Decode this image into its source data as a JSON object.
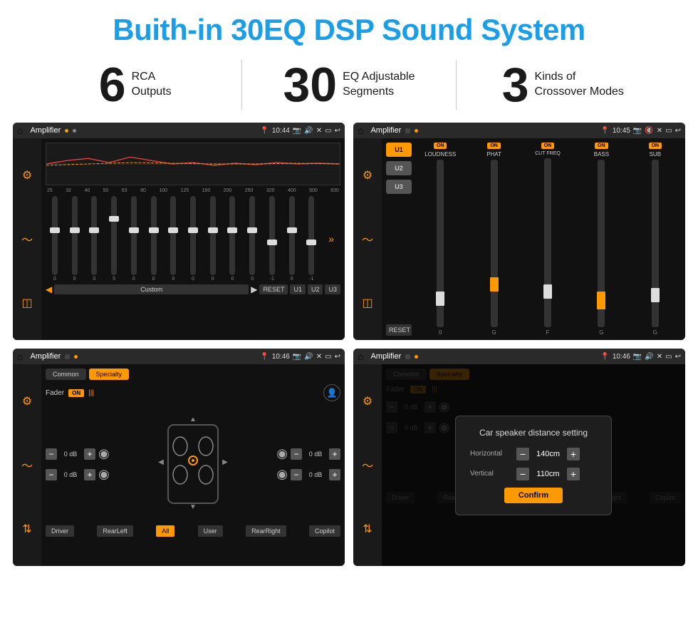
{
  "page": {
    "title": "Buith-in 30EQ DSP Sound System",
    "accent_color": "#1a9ee8"
  },
  "stats": [
    {
      "number": "6",
      "text_line1": "RCA",
      "text_line2": "Outputs"
    },
    {
      "number": "30",
      "text_line1": "EQ Adjustable",
      "text_line2": "Segments"
    },
    {
      "number": "3",
      "text_line1": "Kinds of",
      "text_line2": "Crossover Modes"
    }
  ],
  "screens": [
    {
      "id": "eq-screen",
      "title": "Amplifier",
      "time": "10:44",
      "type": "equalizer"
    },
    {
      "id": "amp-screen",
      "title": "Amplifier",
      "time": "10:45",
      "type": "amplifier"
    },
    {
      "id": "fader-screen",
      "title": "Amplifier",
      "time": "10:46",
      "type": "fader"
    },
    {
      "id": "dialog-screen",
      "title": "Amplifier",
      "time": "10:46",
      "type": "dialog"
    }
  ],
  "eq": {
    "freq_labels": [
      "25",
      "32",
      "40",
      "50",
      "63",
      "80",
      "100",
      "125",
      "160",
      "200",
      "250",
      "320",
      "400",
      "500",
      "630"
    ],
    "values": [
      "0",
      "0",
      "0",
      "5",
      "0",
      "0",
      "0",
      "0",
      "0",
      "0",
      "0",
      "-1",
      "0",
      "-1"
    ],
    "preset": "Custom",
    "buttons": [
      "RESET",
      "U1",
      "U2",
      "U3"
    ]
  },
  "amp": {
    "presets": [
      "U1",
      "U2",
      "U3"
    ],
    "channels": [
      {
        "label": "LOUDNESS",
        "on": true
      },
      {
        "label": "PHAT",
        "on": true
      },
      {
        "label": "CUT FREQ",
        "on": true
      },
      {
        "label": "BASS",
        "on": true
      },
      {
        "label": "SUB",
        "on": true
      }
    ],
    "reset_label": "RESET"
  },
  "fader": {
    "tabs": [
      "Common",
      "Specialty"
    ],
    "active_tab": "Specialty",
    "fader_label": "Fader",
    "on_label": "ON",
    "controls": [
      {
        "value": "0 dB"
      },
      {
        "value": "0 dB"
      },
      {
        "value": "0 dB"
      },
      {
        "value": "0 dB"
      }
    ],
    "buttons": [
      "Driver",
      "RearLeft",
      "All",
      "User",
      "RearRight",
      "Copilot"
    ]
  },
  "dialog": {
    "tabs": [
      "Common",
      "Specialty"
    ],
    "title": "Car speaker distance setting",
    "horizontal_label": "Horizontal",
    "horizontal_value": "140cm",
    "vertical_label": "Vertical",
    "vertical_value": "110cm",
    "confirm_label": "Confirm",
    "side_controls": [
      {
        "value": "0 dB"
      },
      {
        "value": "0 dB"
      }
    ],
    "buttons": [
      "Driver",
      "RearLeft",
      "All",
      "User",
      "RearRight",
      "Copilot"
    ]
  }
}
